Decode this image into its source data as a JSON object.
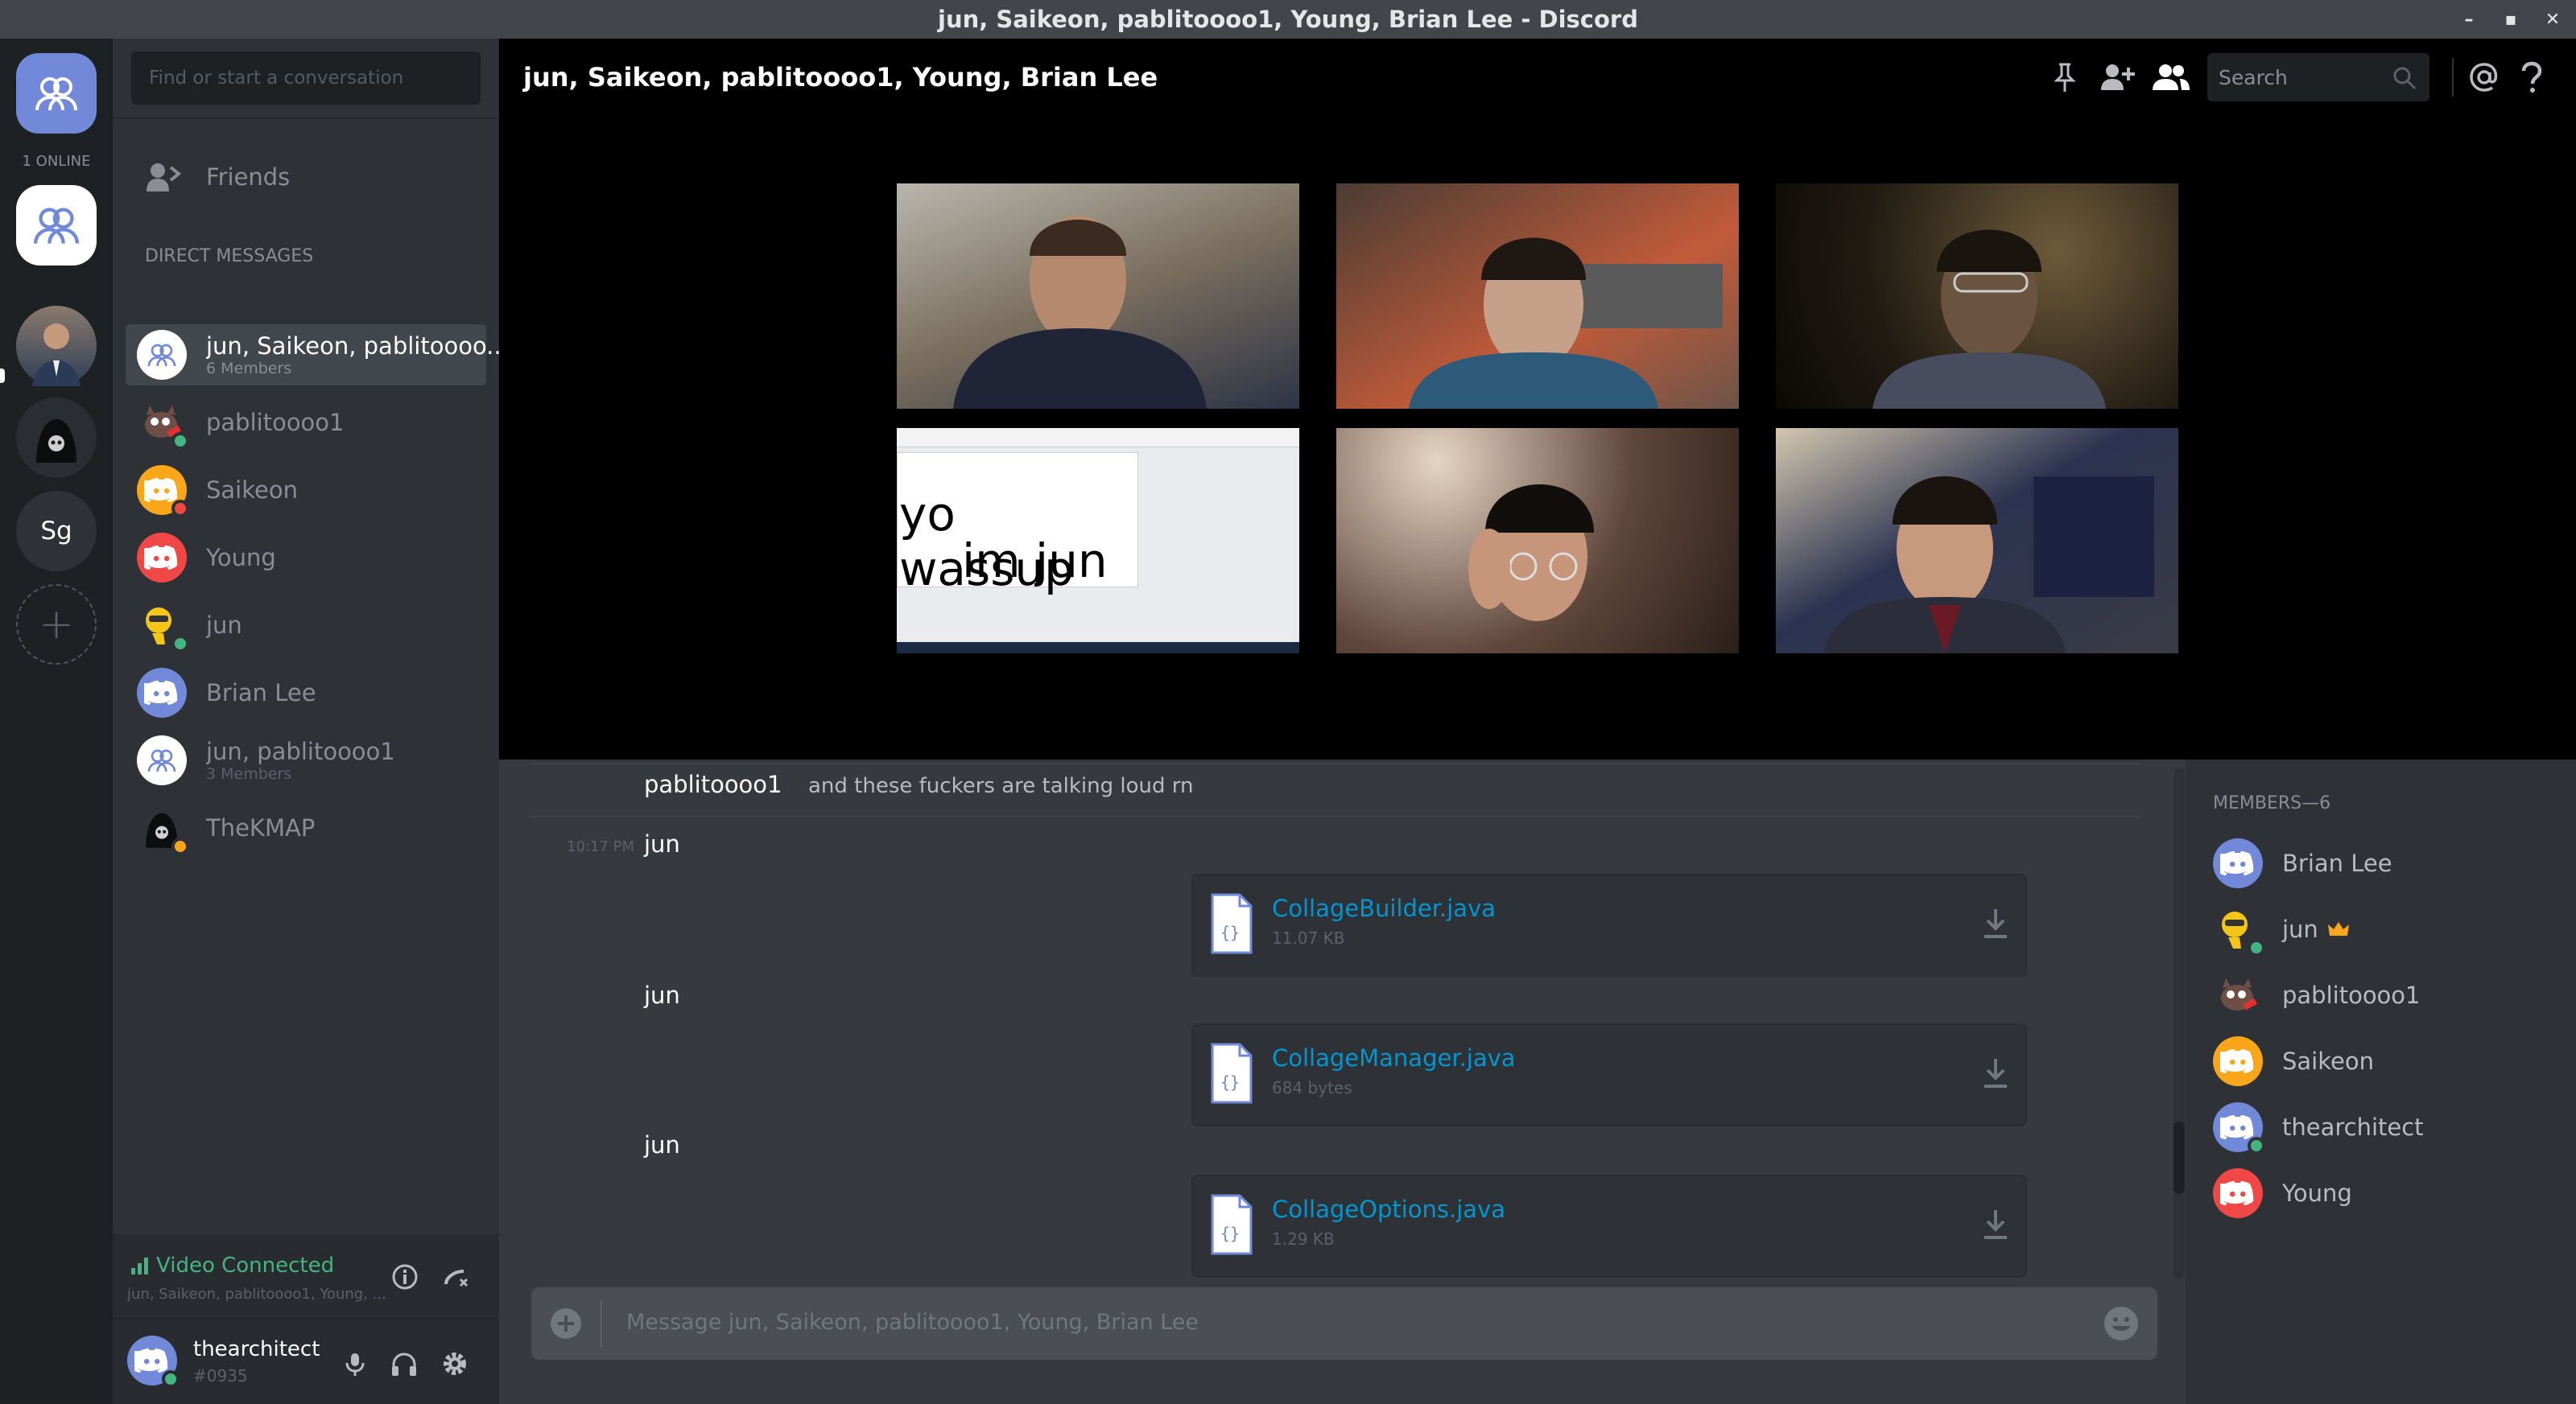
{
  "window": {
    "title": "jun, Saikeon, pablitoooo1, Young, Brian Lee - Discord",
    "controls": [
      "–",
      "▪",
      "✕"
    ]
  },
  "guilds": {
    "online_label": "1 ONLINE",
    "add_label": "+",
    "sg_label": "Sg"
  },
  "dm": {
    "search_placeholder": "Find or start a conversation",
    "friends_label": "Friends",
    "section_label": "DIRECT MESSAGES",
    "items": [
      {
        "name": "jun, Saikeon, pablitoooo...",
        "sub": "6 Members"
      },
      {
        "name": "pablitoooo1"
      },
      {
        "name": "Saikeon"
      },
      {
        "name": "Young"
      },
      {
        "name": "jun"
      },
      {
        "name": "Brian Lee"
      },
      {
        "name": "jun, pablitoooo1",
        "sub": "3 Members"
      },
      {
        "name": "TheKMAP"
      }
    ]
  },
  "voice": {
    "status": "Video Connected",
    "channel": "jun, Saikeon, pablitoooo1, Young, ..."
  },
  "user": {
    "name": "thearchitect",
    "tag": "#0935"
  },
  "header": {
    "title": "jun, Saikeon, pablitoooo1, Young, Brian Lee",
    "search_placeholder": "Search"
  },
  "video": {
    "tile4_text_line1": "yo wassup",
    "tile4_text_line2": "im jun"
  },
  "chat": {
    "m0": {
      "author": "pablitoooo1",
      "text": "and these fuckers are talking loud rn"
    },
    "m1": {
      "time": "10:17 PM",
      "author": "jun",
      "file": "CollageBuilder.java",
      "size": "11.07 KB"
    },
    "m2": {
      "author": "jun",
      "file": "CollageManager.java",
      "size": "684 bytes"
    },
    "m3": {
      "author": "jun",
      "file": "CollageOptions.java",
      "size": "1.29 KB"
    }
  },
  "input": {
    "placeholder": "Message jun, Saikeon, pablitoooo1, Young, Brian Lee"
  },
  "members": {
    "header": "MEMBERS—6",
    "list": [
      {
        "name": "Brian Lee",
        "color": "#7289da"
      },
      {
        "name": "jun",
        "color": "#f5c518"
      },
      {
        "name": "pablitoooo1",
        "color": "#6e4f47"
      },
      {
        "name": "Saikeon",
        "color": "#faa61a"
      },
      {
        "name": "thearchitect",
        "color": "#7289da"
      },
      {
        "name": "Young",
        "color": "#f04747"
      }
    ]
  },
  "colors": {
    "blurple": "#7289da",
    "online": "#43b581",
    "idle": "#faa61a",
    "dnd": "#f04747",
    "link": "#0096cf"
  }
}
